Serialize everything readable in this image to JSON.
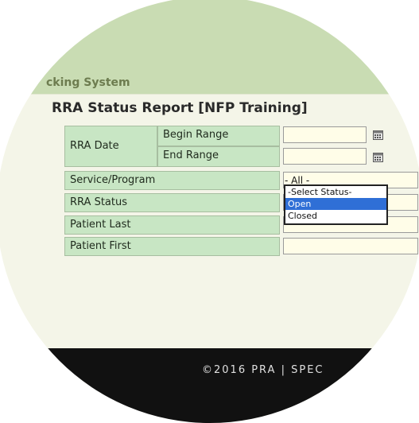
{
  "header": {
    "system_title": "cking System"
  },
  "report": {
    "title": "RRA Status Report [NFP Training]"
  },
  "form": {
    "rra_date_label": "RRA Date",
    "begin_range_label": "Begin Range",
    "end_range_label": "End Range",
    "service_program_label": "Service/Program",
    "rra_status_label": "RRA Status",
    "patient_last_label": "Patient Last",
    "patient_first_label": "Patient First",
    "service_program_value": "- All -",
    "begin_range_value": "",
    "end_range_value": "",
    "patient_last_value": "",
    "patient_first_value": ""
  },
  "status_dropdown": {
    "options": [
      "-Select Status-",
      "Open",
      "Closed"
    ],
    "highlighted": "Open"
  },
  "footer": {
    "text": "©2016 PRA | SPEC"
  },
  "colors": {
    "header_band": "#c9dcb3",
    "label_bg": "#c8e6c4",
    "panel_bg": "#f4f5e8",
    "input_bg": "#fffde8",
    "highlight": "#2f6fd6",
    "footer_bg": "#111111"
  },
  "icons": [
    "calendar-icon"
  ]
}
